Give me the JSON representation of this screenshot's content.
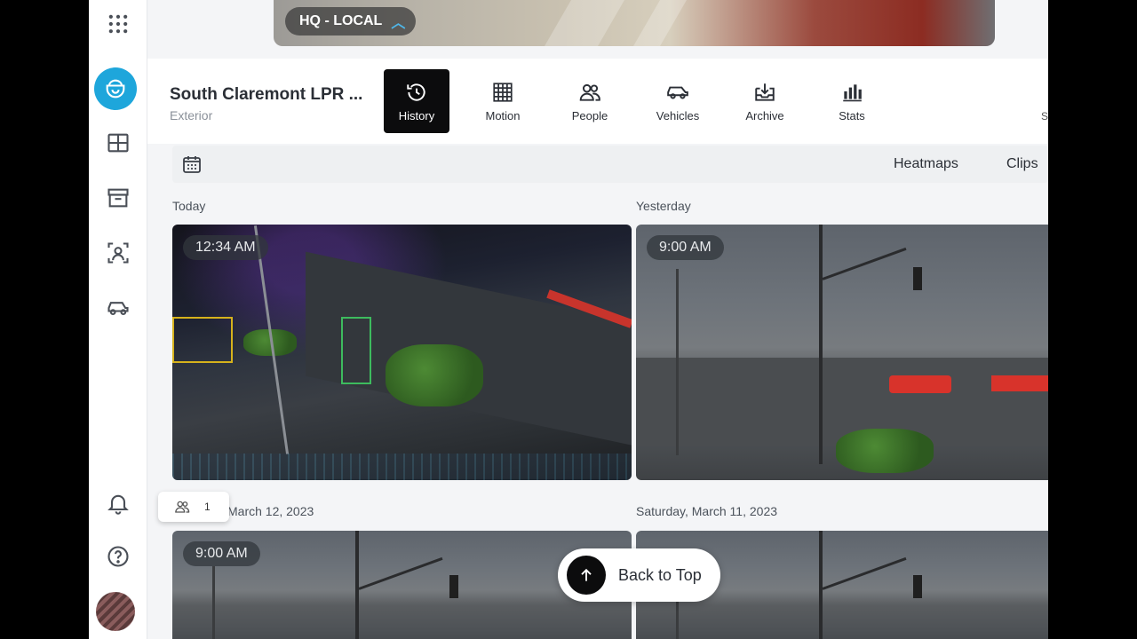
{
  "topbar": {
    "location_label": "HQ - LOCAL"
  },
  "camera": {
    "title": "South Claremont LPR ...",
    "subtitle": "Exterior"
  },
  "tabs": [
    {
      "label": "History",
      "icon": "history-icon",
      "active": true
    },
    {
      "label": "Motion",
      "icon": "motion-grid-icon",
      "active": false
    },
    {
      "label": "People",
      "icon": "people-icon",
      "active": false
    },
    {
      "label": "Vehicles",
      "icon": "vehicle-icon",
      "active": false
    },
    {
      "label": "Archive",
      "icon": "archive-download-icon",
      "active": false
    },
    {
      "label": "Stats",
      "icon": "stats-icon",
      "active": false
    }
  ],
  "header_cut_text": "S",
  "toolbar": {
    "heatmaps_label": "Heatmaps",
    "clips_label": "Clips"
  },
  "groups": [
    {
      "day": "Today",
      "time": "12:34 AM"
    },
    {
      "day": "Yesterday",
      "time": "9:00 AM"
    },
    {
      "day": "March 12, 2023",
      "time": "9:00 AM"
    },
    {
      "day": "Saturday, March 11, 2023",
      "time": ""
    }
  ],
  "people_popover": {
    "count": "1"
  },
  "back_to_top_label": "Back to Top",
  "colors": {
    "accent": "#1ea6db",
    "active_tab": "#0c0c0d"
  }
}
